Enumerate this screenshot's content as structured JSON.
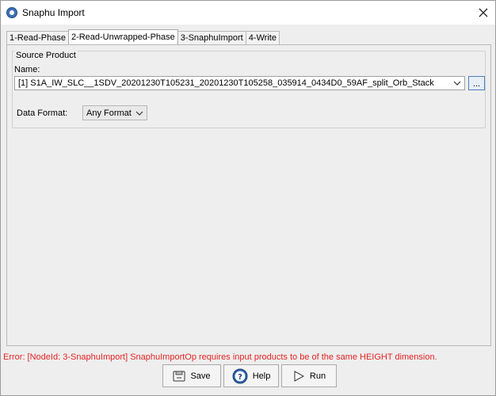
{
  "window": {
    "title": "Snaphu Import"
  },
  "tabs": [
    {
      "label": "1-Read-Phase",
      "active": false
    },
    {
      "label": "2-Read-Unwrapped-Phase",
      "active": true
    },
    {
      "label": "3-SnaphuImport",
      "active": false
    },
    {
      "label": "4-Write",
      "active": false
    }
  ],
  "source_product": {
    "group_title": "Source Product",
    "name_label": "Name:",
    "selected_product": "[1] S1A_IW_SLC__1SDV_20201230T105231_20201230T105258_035914_0434D0_59AF_split_Orb_Stack",
    "browse_label": "...",
    "format_label": "Data Format:",
    "format_value": "Any Format"
  },
  "status": {
    "error_text": "Error: [NodeId: 3-SnaphuImport] SnaphuImportOp requires input products to be of the same HEIGHT dimension.",
    "error_color": "#e32424"
  },
  "buttons": {
    "save": "Save",
    "help": "Help",
    "run": "Run"
  },
  "icons": {
    "app": "snap-app-icon",
    "close": "close-icon",
    "save": "save-icon",
    "help": "help-icon",
    "run": "run-icon"
  }
}
